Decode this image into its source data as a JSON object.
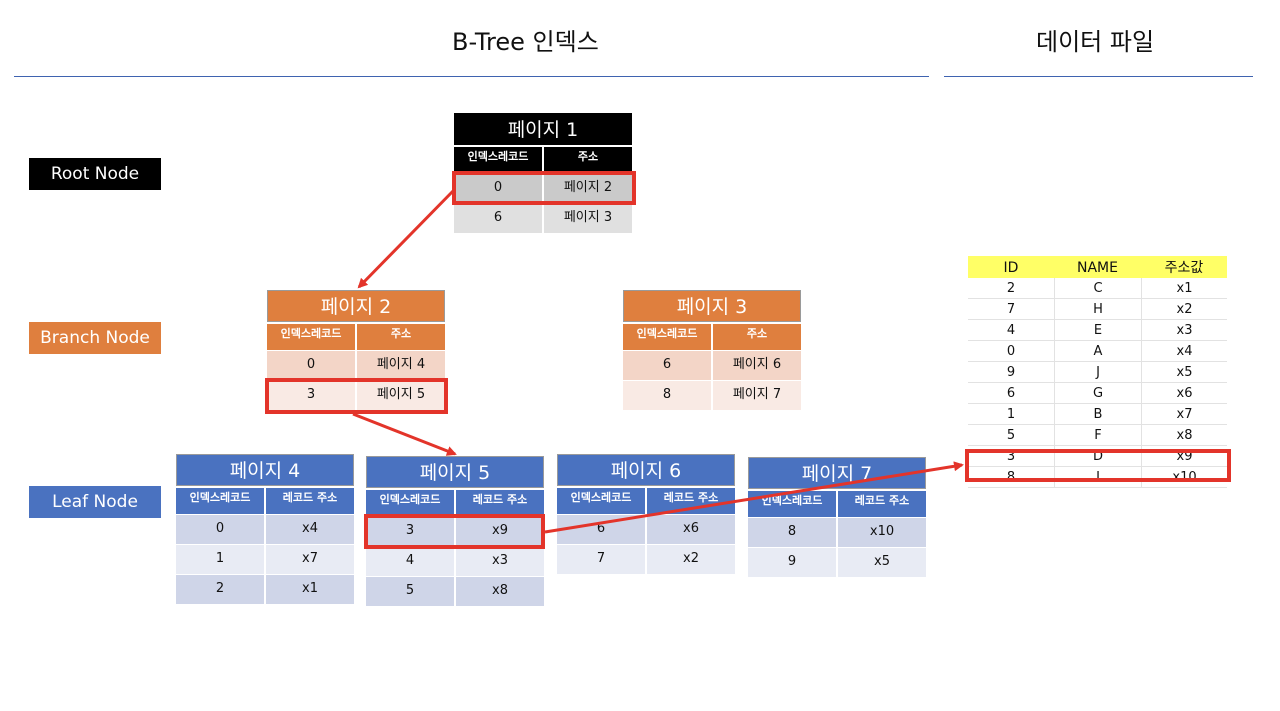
{
  "headings": {
    "btree": "B-Tree 인덱스",
    "datafile": "데이터 파일"
  },
  "levels": {
    "root": "Root Node",
    "branch": "Branch Node",
    "leaf": "Leaf Node"
  },
  "root": {
    "title": "페이지 1",
    "header": [
      "인덱스레코드",
      "주소"
    ],
    "rows": [
      [
        "0",
        "페이지 2"
      ],
      [
        "6",
        "페이지 3"
      ]
    ]
  },
  "branches": [
    {
      "title": "페이지 2",
      "header": [
        "인덱스레코드",
        "주소"
      ],
      "rows": [
        [
          "0",
          "페이지 4"
        ],
        [
          "3",
          "페이지 5"
        ]
      ]
    },
    {
      "title": "페이지 3",
      "header": [
        "인덱스레코드",
        "주소"
      ],
      "rows": [
        [
          "6",
          "페이지 6"
        ],
        [
          "8",
          "페이지 7"
        ]
      ]
    }
  ],
  "leaves": [
    {
      "title": "페이지 4",
      "header": [
        "인덱스레코드",
        "레코드 주소"
      ],
      "rows": [
        [
          "0",
          "x4"
        ],
        [
          "1",
          "x7"
        ],
        [
          "2",
          "x1"
        ]
      ]
    },
    {
      "title": "페이지 5",
      "header": [
        "인덱스레코드",
        "레코드 주소"
      ],
      "rows": [
        [
          "3",
          "x9"
        ],
        [
          "4",
          "x3"
        ],
        [
          "5",
          "x8"
        ]
      ]
    },
    {
      "title": "페이지 6",
      "header": [
        "인덱스레코드",
        "레코드 주소"
      ],
      "rows": [
        [
          "6",
          "x6"
        ],
        [
          "7",
          "x2"
        ]
      ]
    },
    {
      "title": "페이지 7",
      "header": [
        "인덱스레코드",
        "레코드 주소"
      ],
      "rows": [
        [
          "8",
          "x10"
        ],
        [
          "9",
          "x5"
        ]
      ]
    }
  ],
  "datafile": {
    "header": [
      "ID",
      "NAME",
      "주소값"
    ],
    "rows": [
      [
        "2",
        "C",
        "x1"
      ],
      [
        "7",
        "H",
        "x2"
      ],
      [
        "4",
        "E",
        "x3"
      ],
      [
        "0",
        "A",
        "x4"
      ],
      [
        "9",
        "J",
        "x5"
      ],
      [
        "6",
        "G",
        "x6"
      ],
      [
        "1",
        "B",
        "x7"
      ],
      [
        "5",
        "F",
        "x8"
      ],
      [
        "3",
        "D",
        "x9"
      ],
      [
        "8",
        "I",
        "x10"
      ]
    ]
  },
  "colors": {
    "highlight": "#e3342a",
    "root": "#000000",
    "branch": "#df7f3e",
    "leaf": "#4a72c0",
    "data_header": "#ffff66"
  }
}
